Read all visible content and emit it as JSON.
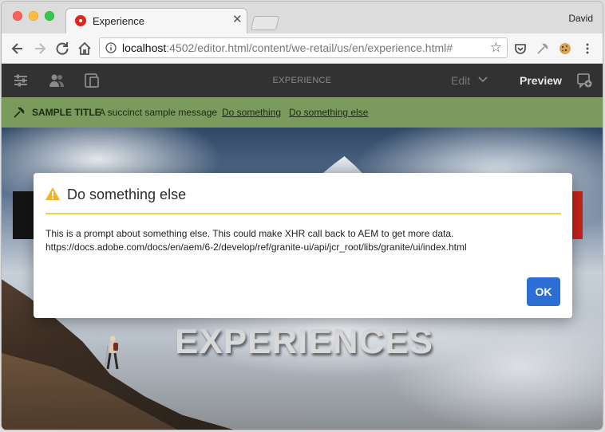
{
  "browser": {
    "tab_title": "Experience",
    "profile_name": "David",
    "url_host": "localhost",
    "url_rest": ":4502/editor.html/content/we-retail/us/en/experience.html#"
  },
  "aem": {
    "page_title": "EXPERIENCE",
    "mode_label": "Edit",
    "preview_label": "Preview"
  },
  "notification": {
    "title": "SAMPLE TITLE",
    "message": "A succinct sample message",
    "link_1": "Do something",
    "link_2": "Do something else",
    "color": "#7a9a5e"
  },
  "hero": {
    "headline": "EXPERIENCES"
  },
  "dialog": {
    "title": "Do something else",
    "body_line_1": "This is a prompt about something else. This could make XHR call back to AEM to get more data.",
    "body_line_2": "https://docs.adobe.com/docs/en/aem/6-2/develop/ref/granite-ui/api/jcr_root/libs/granite/ui/index.html",
    "ok_label": "OK",
    "accent_color": "#f4ce41",
    "button_color": "#2d6ed4"
  }
}
